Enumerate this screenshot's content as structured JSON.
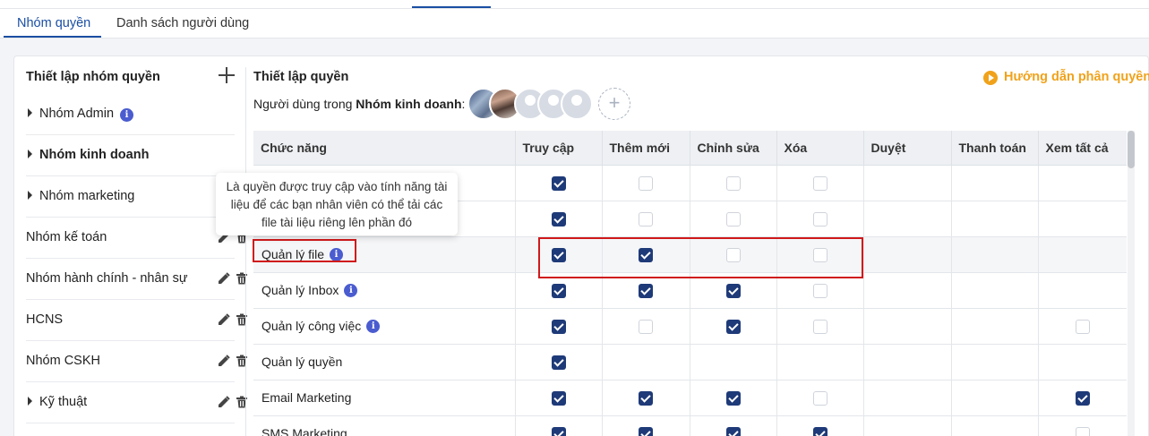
{
  "tabs": [
    {
      "label": "Nhóm quyền",
      "active": true
    },
    {
      "label": "Danh sách người dùng",
      "active": false
    }
  ],
  "left": {
    "title": "Thiết lập nhóm quyền",
    "groups": [
      {
        "label": "Nhóm Admin",
        "expandable": true,
        "info": true,
        "actions": false,
        "bold": false
      },
      {
        "label": "Nhóm kinh doanh",
        "expandable": true,
        "info": false,
        "actions": false,
        "bold": true
      },
      {
        "label": "Nhóm marketing",
        "expandable": true,
        "info": false,
        "actions": true,
        "bold": false
      },
      {
        "label": "Nhóm kế toán",
        "expandable": false,
        "info": false,
        "actions": true,
        "bold": false
      },
      {
        "label": "Nhóm hành chính - nhân sự",
        "expandable": false,
        "info": false,
        "actions": true,
        "bold": false
      },
      {
        "label": "HCNS",
        "expandable": false,
        "info": false,
        "actions": true,
        "bold": false
      },
      {
        "label": "Nhóm CSKH",
        "expandable": false,
        "info": false,
        "actions": true,
        "bold": false
      },
      {
        "label": "Kỹ thuật",
        "expandable": true,
        "info": false,
        "actions": true,
        "bold": false
      }
    ]
  },
  "right": {
    "title": "Thiết lập quyền",
    "guide_label": "Hướng dẫn phân quyền",
    "users_prefix": "Người dùng trong ",
    "users_group": "Nhóm kinh doanh",
    "users_suffix": ":"
  },
  "tooltip": {
    "text": "Là quyền được truy cập vào tính năng tài liệu để các bạn nhân viên có thể tải các file tài liệu riêng lên phần đó"
  },
  "table": {
    "headers": [
      "Chức năng",
      "Truy cập",
      "Thêm mới",
      "Chỉnh sửa",
      "Xóa",
      "Duyệt",
      "Thanh toán",
      "Xem tất cả"
    ],
    "rows": [
      {
        "name": "",
        "info": false,
        "cells": [
          "on",
          "off",
          "off",
          "off",
          "",
          "",
          ""
        ]
      },
      {
        "name": "",
        "info": false,
        "cells": [
          "on",
          "off",
          "off",
          "off",
          "",
          "",
          ""
        ]
      },
      {
        "name": "Quản lý file",
        "info": true,
        "highlight": true,
        "cells": [
          "on",
          "on",
          "off",
          "off",
          "",
          "",
          ""
        ]
      },
      {
        "name": "Quản lý Inbox",
        "info": true,
        "cells": [
          "on",
          "on",
          "on",
          "off",
          "",
          "",
          ""
        ]
      },
      {
        "name": "Quản lý công việc",
        "info": true,
        "cells": [
          "on",
          "off",
          "on",
          "off",
          "",
          "",
          "off"
        ]
      },
      {
        "name": "Quản lý quyền",
        "info": false,
        "cells": [
          "on",
          "",
          "",
          "",
          "",
          "",
          ""
        ]
      },
      {
        "name": "Email Marketing",
        "info": false,
        "cells": [
          "on",
          "on",
          "on",
          "off",
          "",
          "",
          "on"
        ]
      },
      {
        "name": "SMS Marketing",
        "info": false,
        "cells": [
          "on",
          "on",
          "on",
          "on",
          "",
          "",
          "off"
        ]
      }
    ]
  }
}
